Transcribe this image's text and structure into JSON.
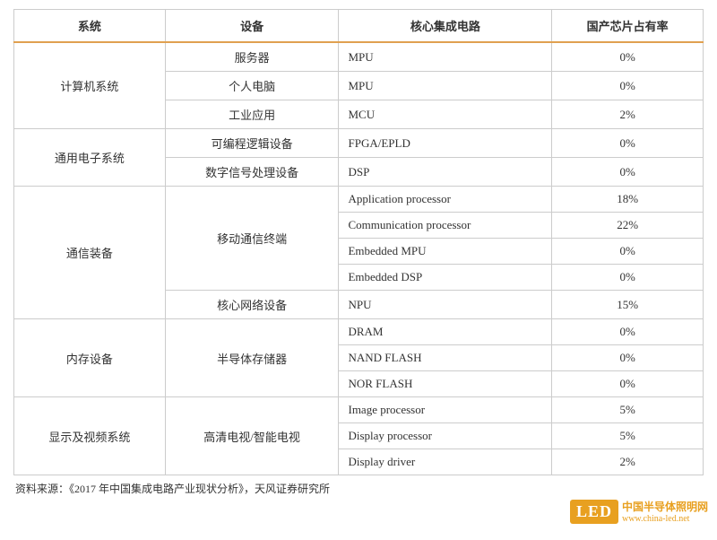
{
  "table": {
    "headers": [
      "系统",
      "设备",
      "核心集成电路",
      "国产芯片占有率"
    ],
    "rows": [
      {
        "system": "计算机系统",
        "system_rowspan": 3,
        "device": "服务器",
        "device_rowspan": 1,
        "ic": "MPU",
        "rate": "0%"
      },
      {
        "system": null,
        "device": "个人电脑",
        "device_rowspan": 1,
        "ic": "MPU",
        "rate": "0%"
      },
      {
        "system": null,
        "device": "工业应用",
        "device_rowspan": 1,
        "ic": "MCU",
        "rate": "2%"
      },
      {
        "system": "通用电子系统",
        "system_rowspan": 2,
        "device": "可编程逻辑设备",
        "device_rowspan": 1,
        "ic": "FPGA/EPLD",
        "rate": "0%"
      },
      {
        "system": null,
        "device": "数字信号处理设备",
        "device_rowspan": 1,
        "ic": "DSP",
        "rate": "0%"
      },
      {
        "system": "通信装备",
        "system_rowspan": 6,
        "device": "移动通信终端",
        "device_rowspan": 4,
        "ic": "Application processor",
        "rate": "18%"
      },
      {
        "system": null,
        "device": null,
        "ic": "Communication processor",
        "rate": "22%"
      },
      {
        "system": null,
        "device": null,
        "ic": "Embedded MPU",
        "rate": "0%"
      },
      {
        "system": null,
        "device": null,
        "ic": "Embedded DSP",
        "rate": "0%"
      },
      {
        "system": null,
        "device": "核心网络设备",
        "device_rowspan": 1,
        "ic": "NPU",
        "rate": "15%"
      },
      {
        "system": "内存设备",
        "system_rowspan": 3,
        "device": "半导体存储器",
        "device_rowspan": 3,
        "ic": "DRAM",
        "rate": "0%"
      },
      {
        "system": null,
        "device": null,
        "ic": "NAND FLASH",
        "rate": "0%"
      },
      {
        "system": null,
        "device": null,
        "ic": "NOR FLASH",
        "rate": "0%"
      },
      {
        "system": "显示及视频系统",
        "system_rowspan": 3,
        "device": "高清电视/智能电视",
        "device_rowspan": 3,
        "ic": "Image processor",
        "rate": "5%"
      },
      {
        "system": null,
        "device": null,
        "ic": "Display processor",
        "rate": "5%"
      },
      {
        "system": null,
        "device": null,
        "ic": "Display driver",
        "rate": "2%"
      }
    ],
    "footer": "资料来源：《2017 年中国集成电路产业现状分析》，天风证券研究所"
  },
  "watermark": {
    "led": "LED",
    "text": "中国半导体照明网",
    "url": "www.china-led.net"
  }
}
